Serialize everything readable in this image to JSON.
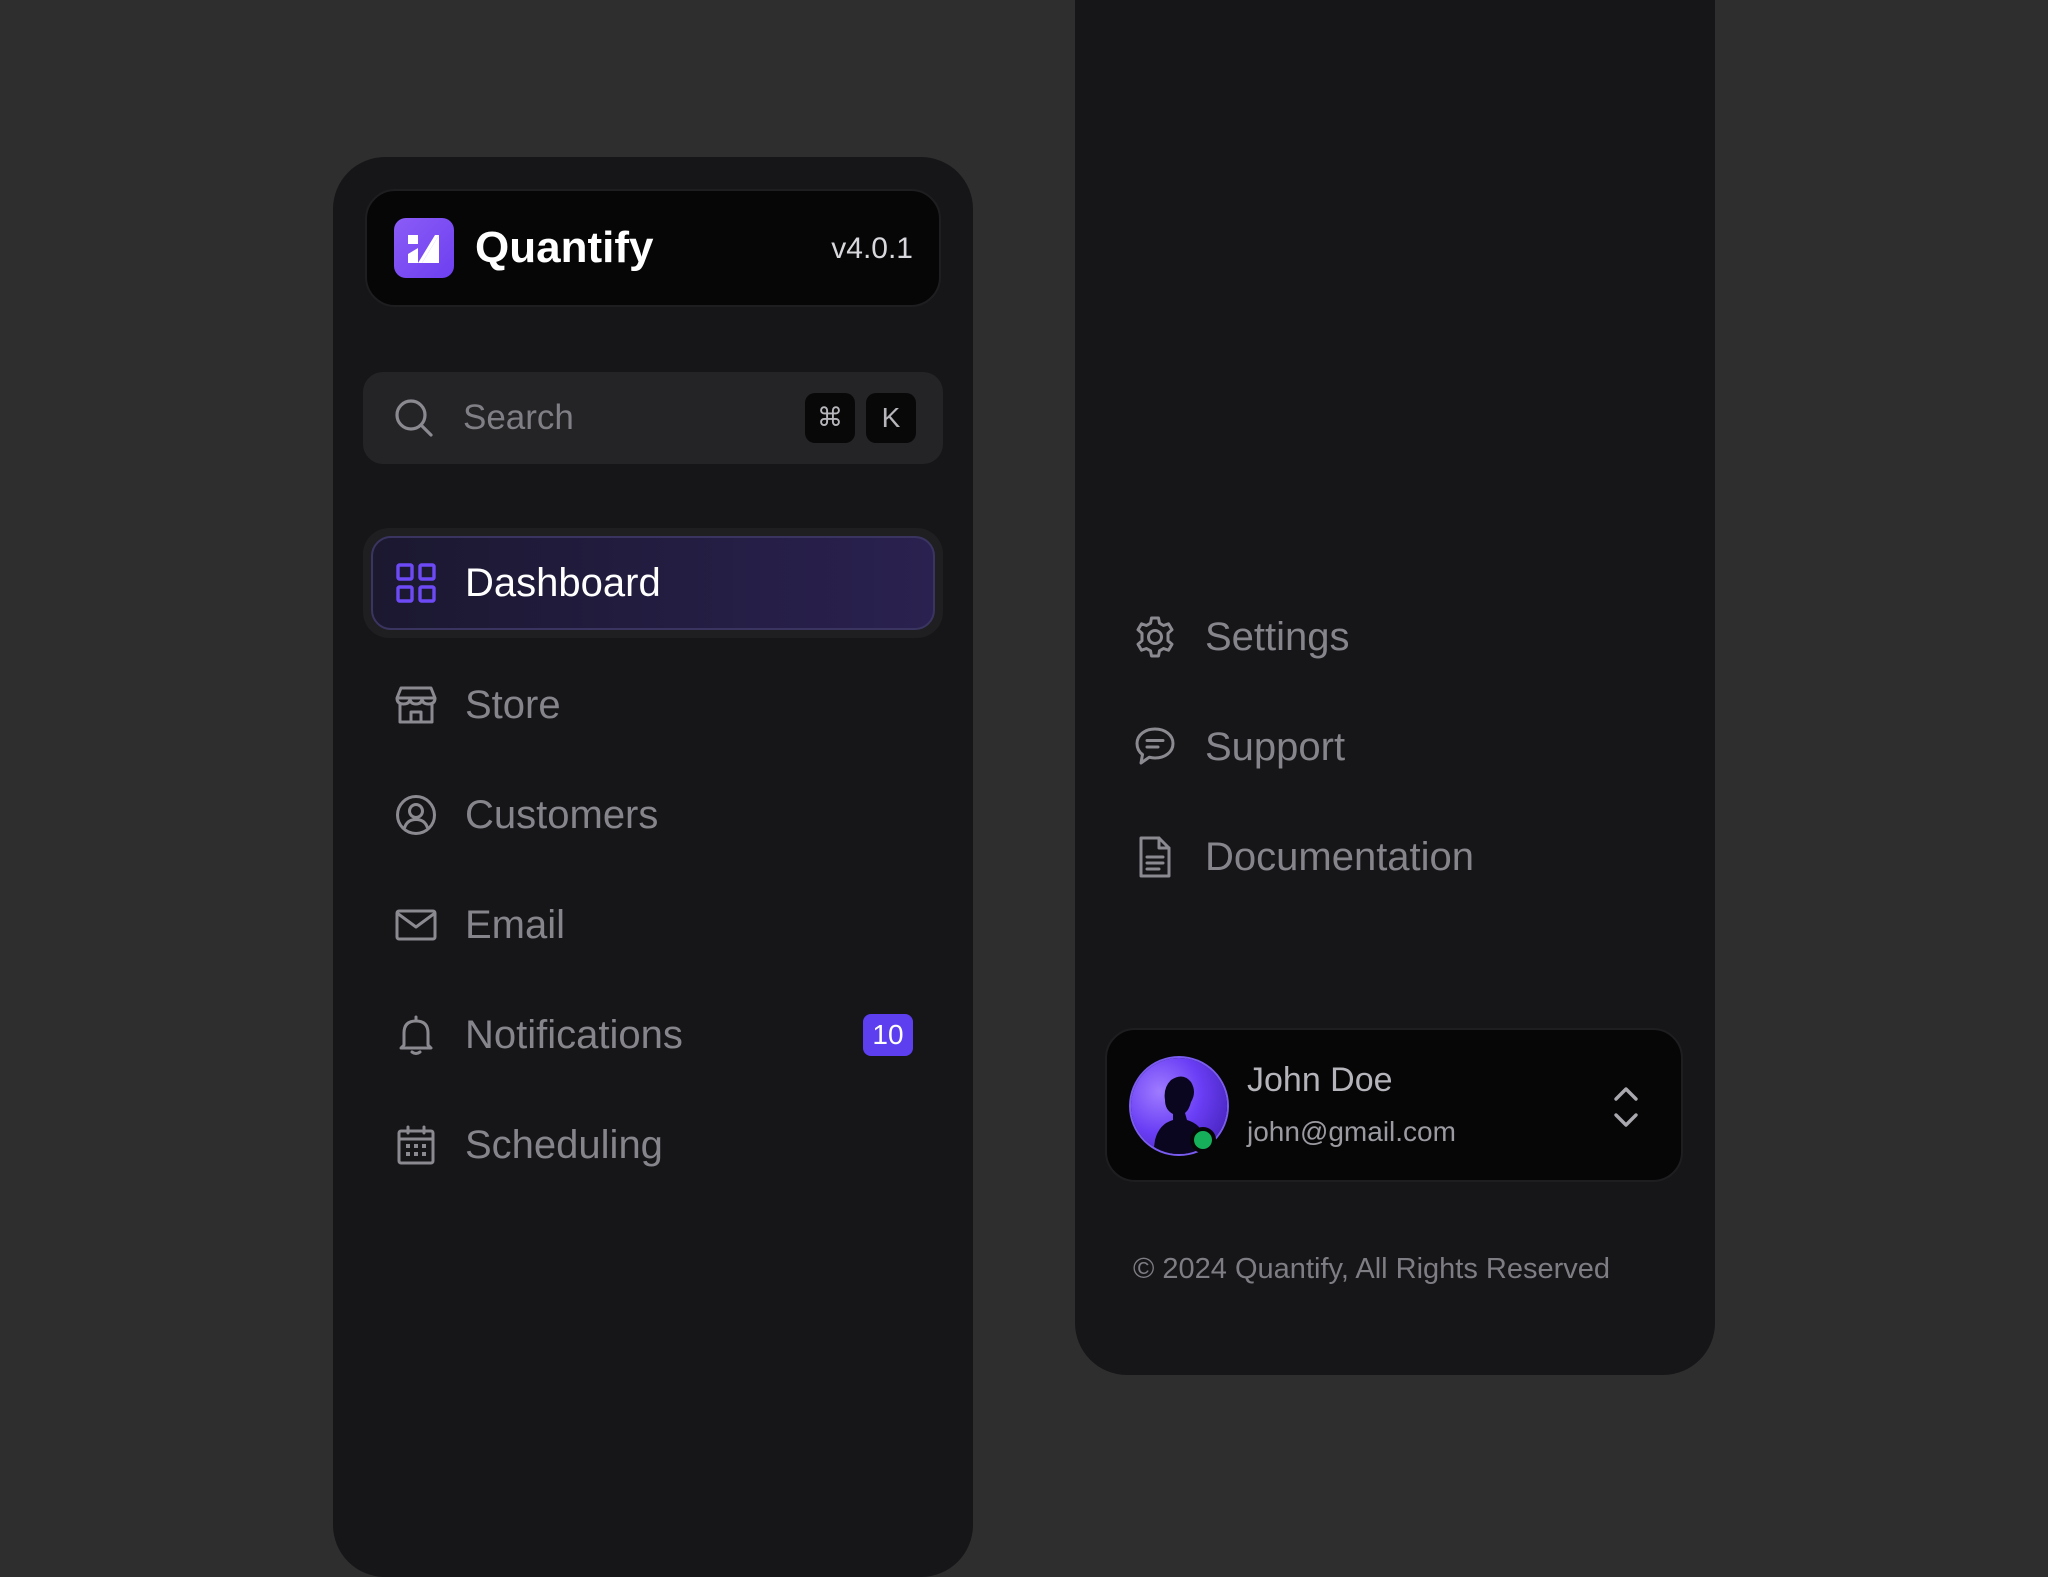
{
  "brand": {
    "name": "Quantify",
    "version": "v4.0.1",
    "logo_icon": "quantify-logo-icon",
    "accent_color": "#6d3ff0"
  },
  "search": {
    "placeholder": "Search",
    "shortcut_modifier": "⌘",
    "shortcut_key": "K"
  },
  "nav": {
    "items": [
      {
        "label": "Dashboard",
        "icon": "grid-icon",
        "active": true
      },
      {
        "label": "Store",
        "icon": "store-icon"
      },
      {
        "label": "Customers",
        "icon": "user-circle-icon"
      },
      {
        "label": "Email",
        "icon": "envelope-icon"
      },
      {
        "label": "Notifications",
        "icon": "bell-icon",
        "badge": "10"
      },
      {
        "label": "Scheduling",
        "icon": "calendar-icon"
      }
    ]
  },
  "secondary": {
    "items": [
      {
        "label": "Settings",
        "icon": "gear-icon"
      },
      {
        "label": "Support",
        "icon": "chat-bubble-icon"
      },
      {
        "label": "Documentation",
        "icon": "document-icon"
      }
    ]
  },
  "user": {
    "name": "John Doe",
    "email": "john@gmail.com",
    "status": "online",
    "status_color": "#16b05a"
  },
  "footer": {
    "copyright": "© 2024 Quantify, All Rights Reserved"
  }
}
